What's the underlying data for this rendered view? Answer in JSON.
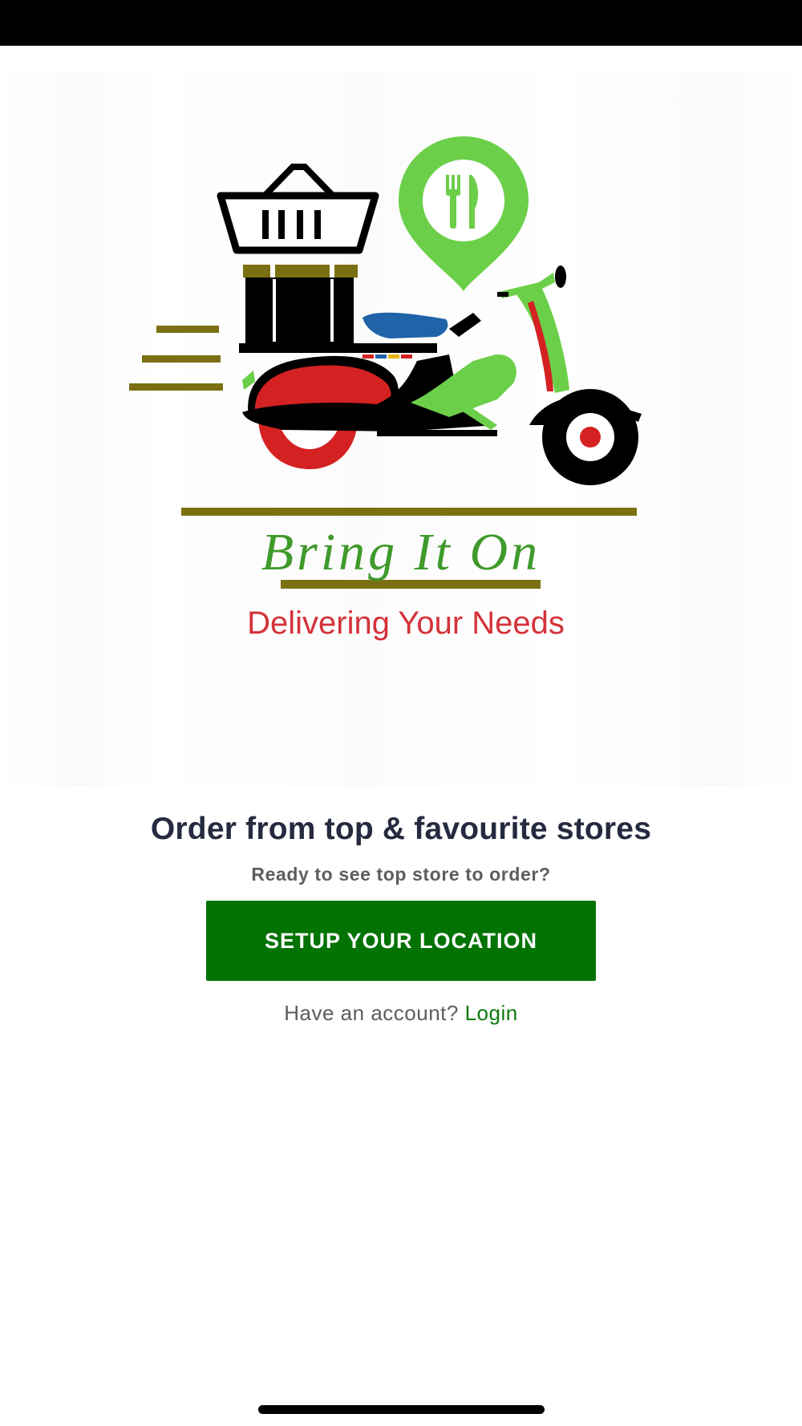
{
  "logo": {
    "brand_name": "Bring It On",
    "tagline": "Delivering Your Needs",
    "colors": {
      "green": "#6ccf4a",
      "red": "#d42222",
      "olive": "#7a7012",
      "blue": "#1f63a8",
      "black": "#000000"
    }
  },
  "main": {
    "headline": "Order from top & favourite stores",
    "subheadline": "Ready to see top store to order?",
    "cta_label": "SETUP YOUR LOCATION",
    "account_prompt": "Have an account?",
    "login_label": "Login"
  },
  "theme": {
    "primary": "#037304",
    "link": "#0a7a0a",
    "headline_color": "#262a40",
    "muted_text": "#5d5d5d"
  }
}
